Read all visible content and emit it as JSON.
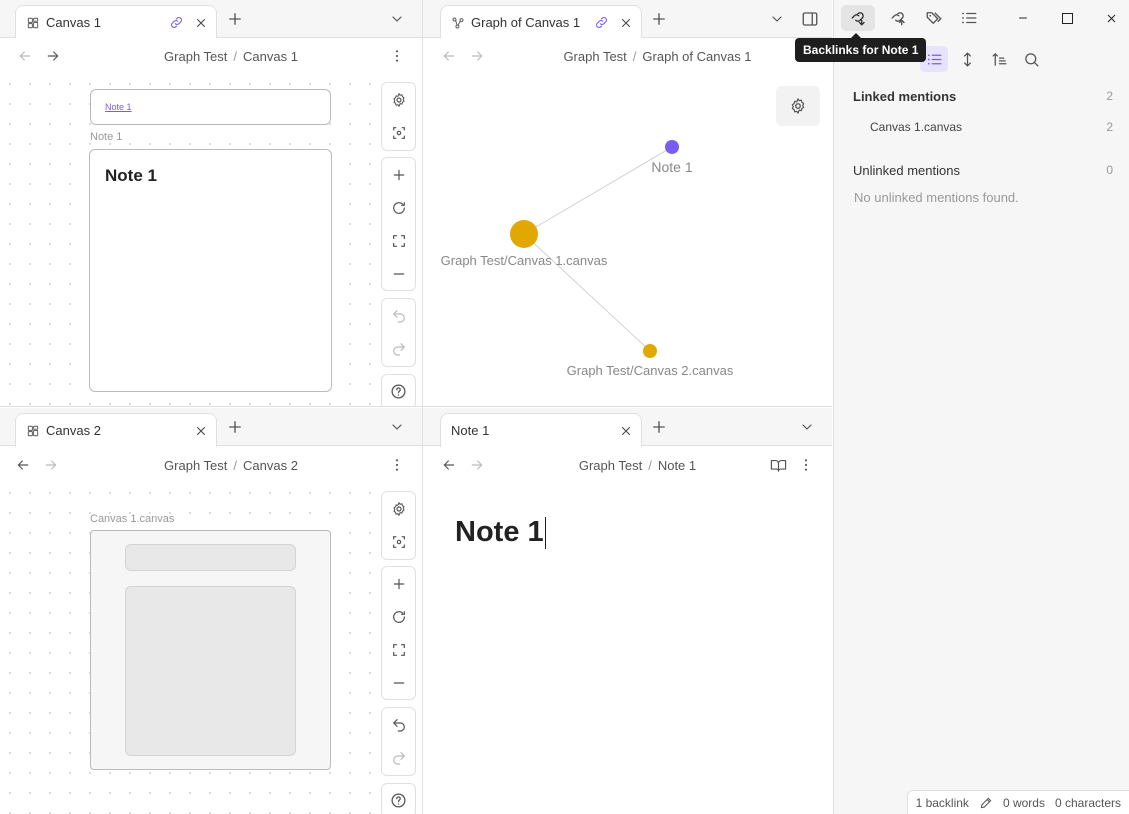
{
  "top_left": {
    "tab": {
      "label": "Canvas 1",
      "icon": "canvas-icon"
    },
    "breadcrumb": {
      "parent": "Graph Test",
      "sep": "/",
      "current": "Canvas 1"
    },
    "canvas": {
      "small_card_link": "Note 1",
      "file_label": "Note 1",
      "card_title": "Note 1"
    }
  },
  "top_middle": {
    "tab": {
      "label": "Graph of Canvas 1",
      "icon": "graph-icon"
    },
    "breadcrumb": {
      "parent": "Graph Test",
      "sep": "/",
      "current": "Graph of Canvas 1"
    },
    "graph": {
      "nodes": [
        {
          "label": "Note 1",
          "color": "#7b5cf0"
        },
        {
          "label": "Graph Test/Canvas 1.canvas",
          "color": "#e0a800"
        },
        {
          "label": "Graph Test/Canvas 2.canvas",
          "color": "#e0a800"
        }
      ]
    }
  },
  "bottom_left": {
    "tab": {
      "label": "Canvas 2",
      "icon": "canvas-icon"
    },
    "breadcrumb": {
      "parent": "Graph Test",
      "sep": "/",
      "current": "Canvas 2"
    },
    "canvas": {
      "file_label": "Canvas 1.canvas"
    }
  },
  "bottom_middle": {
    "tab": {
      "label": "Note 1"
    },
    "breadcrumb": {
      "parent": "Graph Test",
      "sep": "/",
      "current": "Note 1"
    },
    "editor": {
      "heading": "Note 1"
    }
  },
  "sidebar": {
    "tooltip": "Backlinks for Note 1",
    "linked": {
      "title": "Linked mentions",
      "count": "2",
      "items": [
        {
          "name": "Canvas 1.canvas",
          "count": "2"
        }
      ]
    },
    "unlinked": {
      "title": "Unlinked mentions",
      "count": "0",
      "empty": "No unlinked mentions found."
    }
  },
  "status": {
    "backlinks": "1 backlink",
    "words": "0 words",
    "chars": "0 characters"
  },
  "colors": {
    "accent": "#7b5cf0",
    "node_gold": "#e0a800"
  }
}
